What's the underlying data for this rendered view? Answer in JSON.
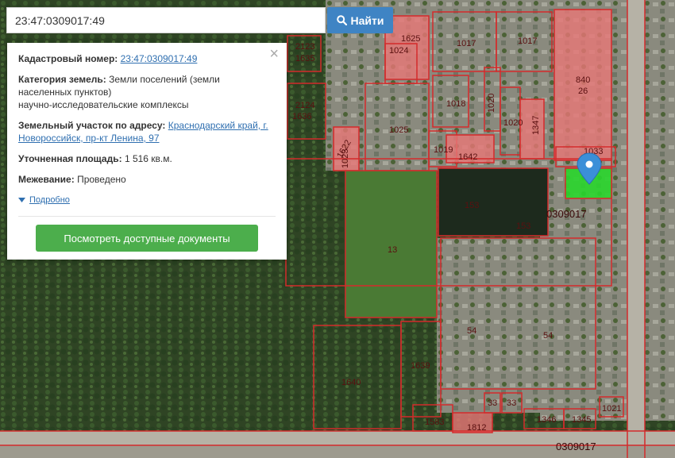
{
  "search": {
    "value": "23:47:0309017:49",
    "button_label": "Найти",
    "button_icon": "search-icon"
  },
  "info": {
    "cadastral_label": "Кадастровый номер:",
    "cadastral_value": "23:47:0309017:49",
    "category_label": "Категория земель:",
    "category_value": "Земли поселений (земли населенных пунктов)",
    "category_value_2": "научно-исследовательские комплексы",
    "address_label": "Земельный участок по адресу:",
    "address_value": "Краснодарский край, г. Новороссийск, пр-кт Ленина, 97",
    "area_label": "Уточненная площадь:",
    "area_value": "1 516 кв.м.",
    "survey_label": "Межевание:",
    "survey_value": "Проведено",
    "more_label": "Подробно",
    "docs_button": "Посмотреть доступные документы",
    "close_symbol": "×"
  },
  "map": {
    "plots": [
      "1625",
      "1024",
      "1017",
      "1017",
      "2123",
      "1635",
      "840",
      "26",
      "1018",
      "1020",
      "1020",
      "1347",
      "2124",
      "1636",
      "1025",
      "1019",
      "1642",
      "1023",
      "1622",
      "1033",
      "153",
      "153",
      "13",
      "54",
      "54",
      "1639",
      "1640",
      "1583",
      "1812",
      "33",
      "33",
      "1346",
      "1345",
      "1021"
    ],
    "quarter_label": "0309017",
    "quarter_label_bottom": "0309017",
    "colors": {
      "plot_border": "#d42b2b",
      "plot_fill": "#e87777",
      "selected_fill": "#29d62c",
      "marker": "#3b8fd8"
    }
  }
}
